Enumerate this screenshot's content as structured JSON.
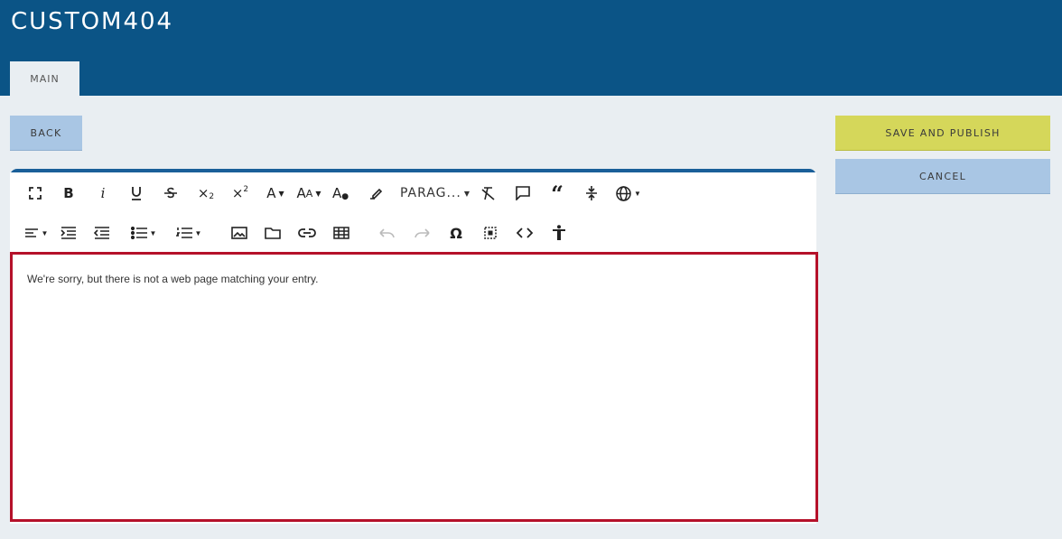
{
  "header": {
    "title": "CUSTOM404"
  },
  "tabs": [
    {
      "label": "MAIN"
    }
  ],
  "actions": {
    "back_label": "BACK",
    "save_label": "SAVE AND PUBLISH",
    "cancel_label": "CANCEL"
  },
  "toolbar": {
    "paragraph_label": "PARAG...",
    "row1_icons": [
      "fullscreen-icon",
      "bold-icon",
      "italic-icon",
      "underline-icon",
      "strikethrough-icon",
      "subscript-icon",
      "superscript-icon",
      "font-family-icon",
      "font-size-icon",
      "text-color-icon",
      "background-color-icon",
      "paragraph-format-dropdown",
      "clear-formatting-icon",
      "comment-icon",
      "quote-icon",
      "insert-hr-icon",
      "language-icon"
    ],
    "row2_icons": [
      "align-icon",
      "indent-icon",
      "outdent-icon",
      "unordered-list-icon",
      "ordered-list-icon",
      "insert-image-icon",
      "insert-file-icon",
      "insert-link-icon",
      "insert-table-icon",
      "undo-icon",
      "redo-icon",
      "special-characters-icon",
      "select-all-icon",
      "code-view-icon",
      "accessibility-icon"
    ]
  },
  "editor": {
    "content": "We're sorry, but there is not a web page matching your entry."
  },
  "colors": {
    "header_bg": "#0b5486",
    "save_bg": "#d5d75a",
    "secondary_bg": "#a9c6e4",
    "focus_border": "#b5112a"
  }
}
